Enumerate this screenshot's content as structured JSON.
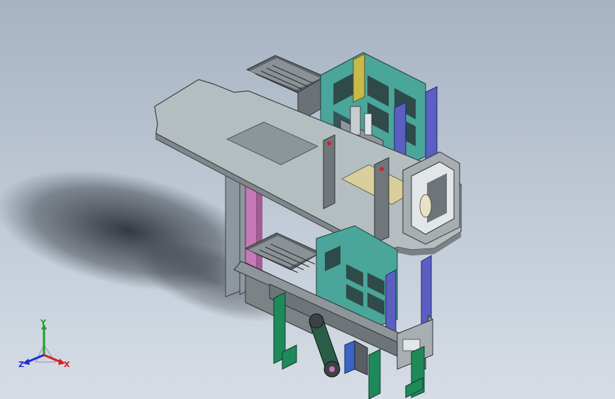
{
  "viewport": {
    "background_top": "#a7b3c3",
    "background_bottom": "#d6dde6"
  },
  "triad": {
    "x_label": "X",
    "y_label": "Y",
    "z_label": "Z",
    "x_color": "#d62020",
    "y_color": "#1f9e2a",
    "z_color": "#1d2fd6"
  },
  "model": {
    "colors": {
      "frame": "#9aa3a8",
      "plate": "#b4bdbf",
      "teal": "#4aa59a",
      "green": "#1e8a5a",
      "magenta": "#c678b8",
      "purple": "#5b5fc2",
      "yellow": "#c9b84a",
      "dark": "#3f4448",
      "blue": "#3c63c8"
    }
  }
}
